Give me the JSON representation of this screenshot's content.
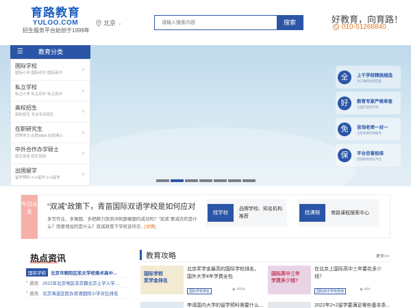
{
  "header": {
    "logo_cn": "育路教育",
    "logo_en": "YULOO.COM",
    "slogan": "招生服务平台始创于1999年",
    "city": "北京",
    "search_placeholder": "请输入搜索内容",
    "search_button": "搜索",
    "tagline": "好教育，向育路！",
    "phone": "010-51268840"
  },
  "category_menu": {
    "title": "教育分类",
    "items": [
      {
        "title": "国际学校",
        "sub": "国际小学  国际初中  国际高中"
      },
      {
        "title": "私立学校",
        "sub": "私立小学  私立初中  私立高中"
      },
      {
        "title": "高校招生",
        "sub": "高校招生  专业专业招生"
      },
      {
        "title": "在职研究生",
        "sub": "同等学力  在职MBA  在职博士"
      },
      {
        "title": "中外合作办学硕士",
        "sub": "招生信息  招生院校"
      },
      {
        "title": "出国留学",
        "sub": "留学预科  3+2留学  2+2留学"
      }
    ]
  },
  "side_services": [
    {
      "icon": "全",
      "title": "上千学校精挑细选",
      "sub": "对口课程免费匹配"
    },
    {
      "icon": "好",
      "title": "教育专家严格审查",
      "sub": "全面打造好学校"
    },
    {
      "icon": "免",
      "title": "咨询老师一对一",
      "sub": "全程免费咨询服务"
    },
    {
      "icon": "保",
      "title": "平台信誉担保",
      "sub": "百强教育供应平台"
    }
  ],
  "headline": {
    "tag": "今日头条",
    "title": "“双减”政策下，青苗国际双语学校是如何应对",
    "desc": "作业、多做题、多把精力放到冲刺题做题的成功吗？“双减”要减去的是什么？而要增加的是什么？双减政策下学校该何去...",
    "desc_prefix": "多写",
    "detail": "[详情]",
    "cards": [
      {
        "badge": "找学校",
        "text": "品牌学校、知名机构推荐"
      },
      {
        "badge": "找课程",
        "text": "育路课程搜索中心"
      }
    ]
  },
  "hot_news": {
    "title": "热点资讯",
    "rows": [
      {
        "tag": "国际学校",
        "kind": "",
        "text": "北京市朝阳区凯文学校美术高中..."
      },
      {
        "tag": "",
        "kind": "资讯",
        "text": "2022年北京地区非京籍北京上学入学..."
      },
      {
        "tag": "",
        "kind": "资讯",
        "text": "北京海淀区民办双语国际小学对比排名"
      }
    ]
  },
  "guides": {
    "title": "教育攻略",
    "more": "更多>>",
    "cards": [
      {
        "img_text": "国际学校\n奖学金排名",
        "text": "北京奖学金最高的国际学校排名，国外大学4年学费全包",
        "tag": "国际学校排名",
        "views": "4994"
      },
      {
        "img_text": "国际高中三年\n学费多少钱?",
        "text": "在北京上国际高中三年要花多少钱？",
        "tag": "国际高中学校费用",
        "views": "464"
      }
    ],
    "next_titles": [
      "申请国内大学的留学预科需要什么...",
      "2022年2+2留学要满足哪些基本条..."
    ]
  },
  "colors": {
    "brand_blue": "#2b55a6",
    "accent_orange": "#e8731a",
    "headline_tag_pink": "#f6b0a9"
  }
}
